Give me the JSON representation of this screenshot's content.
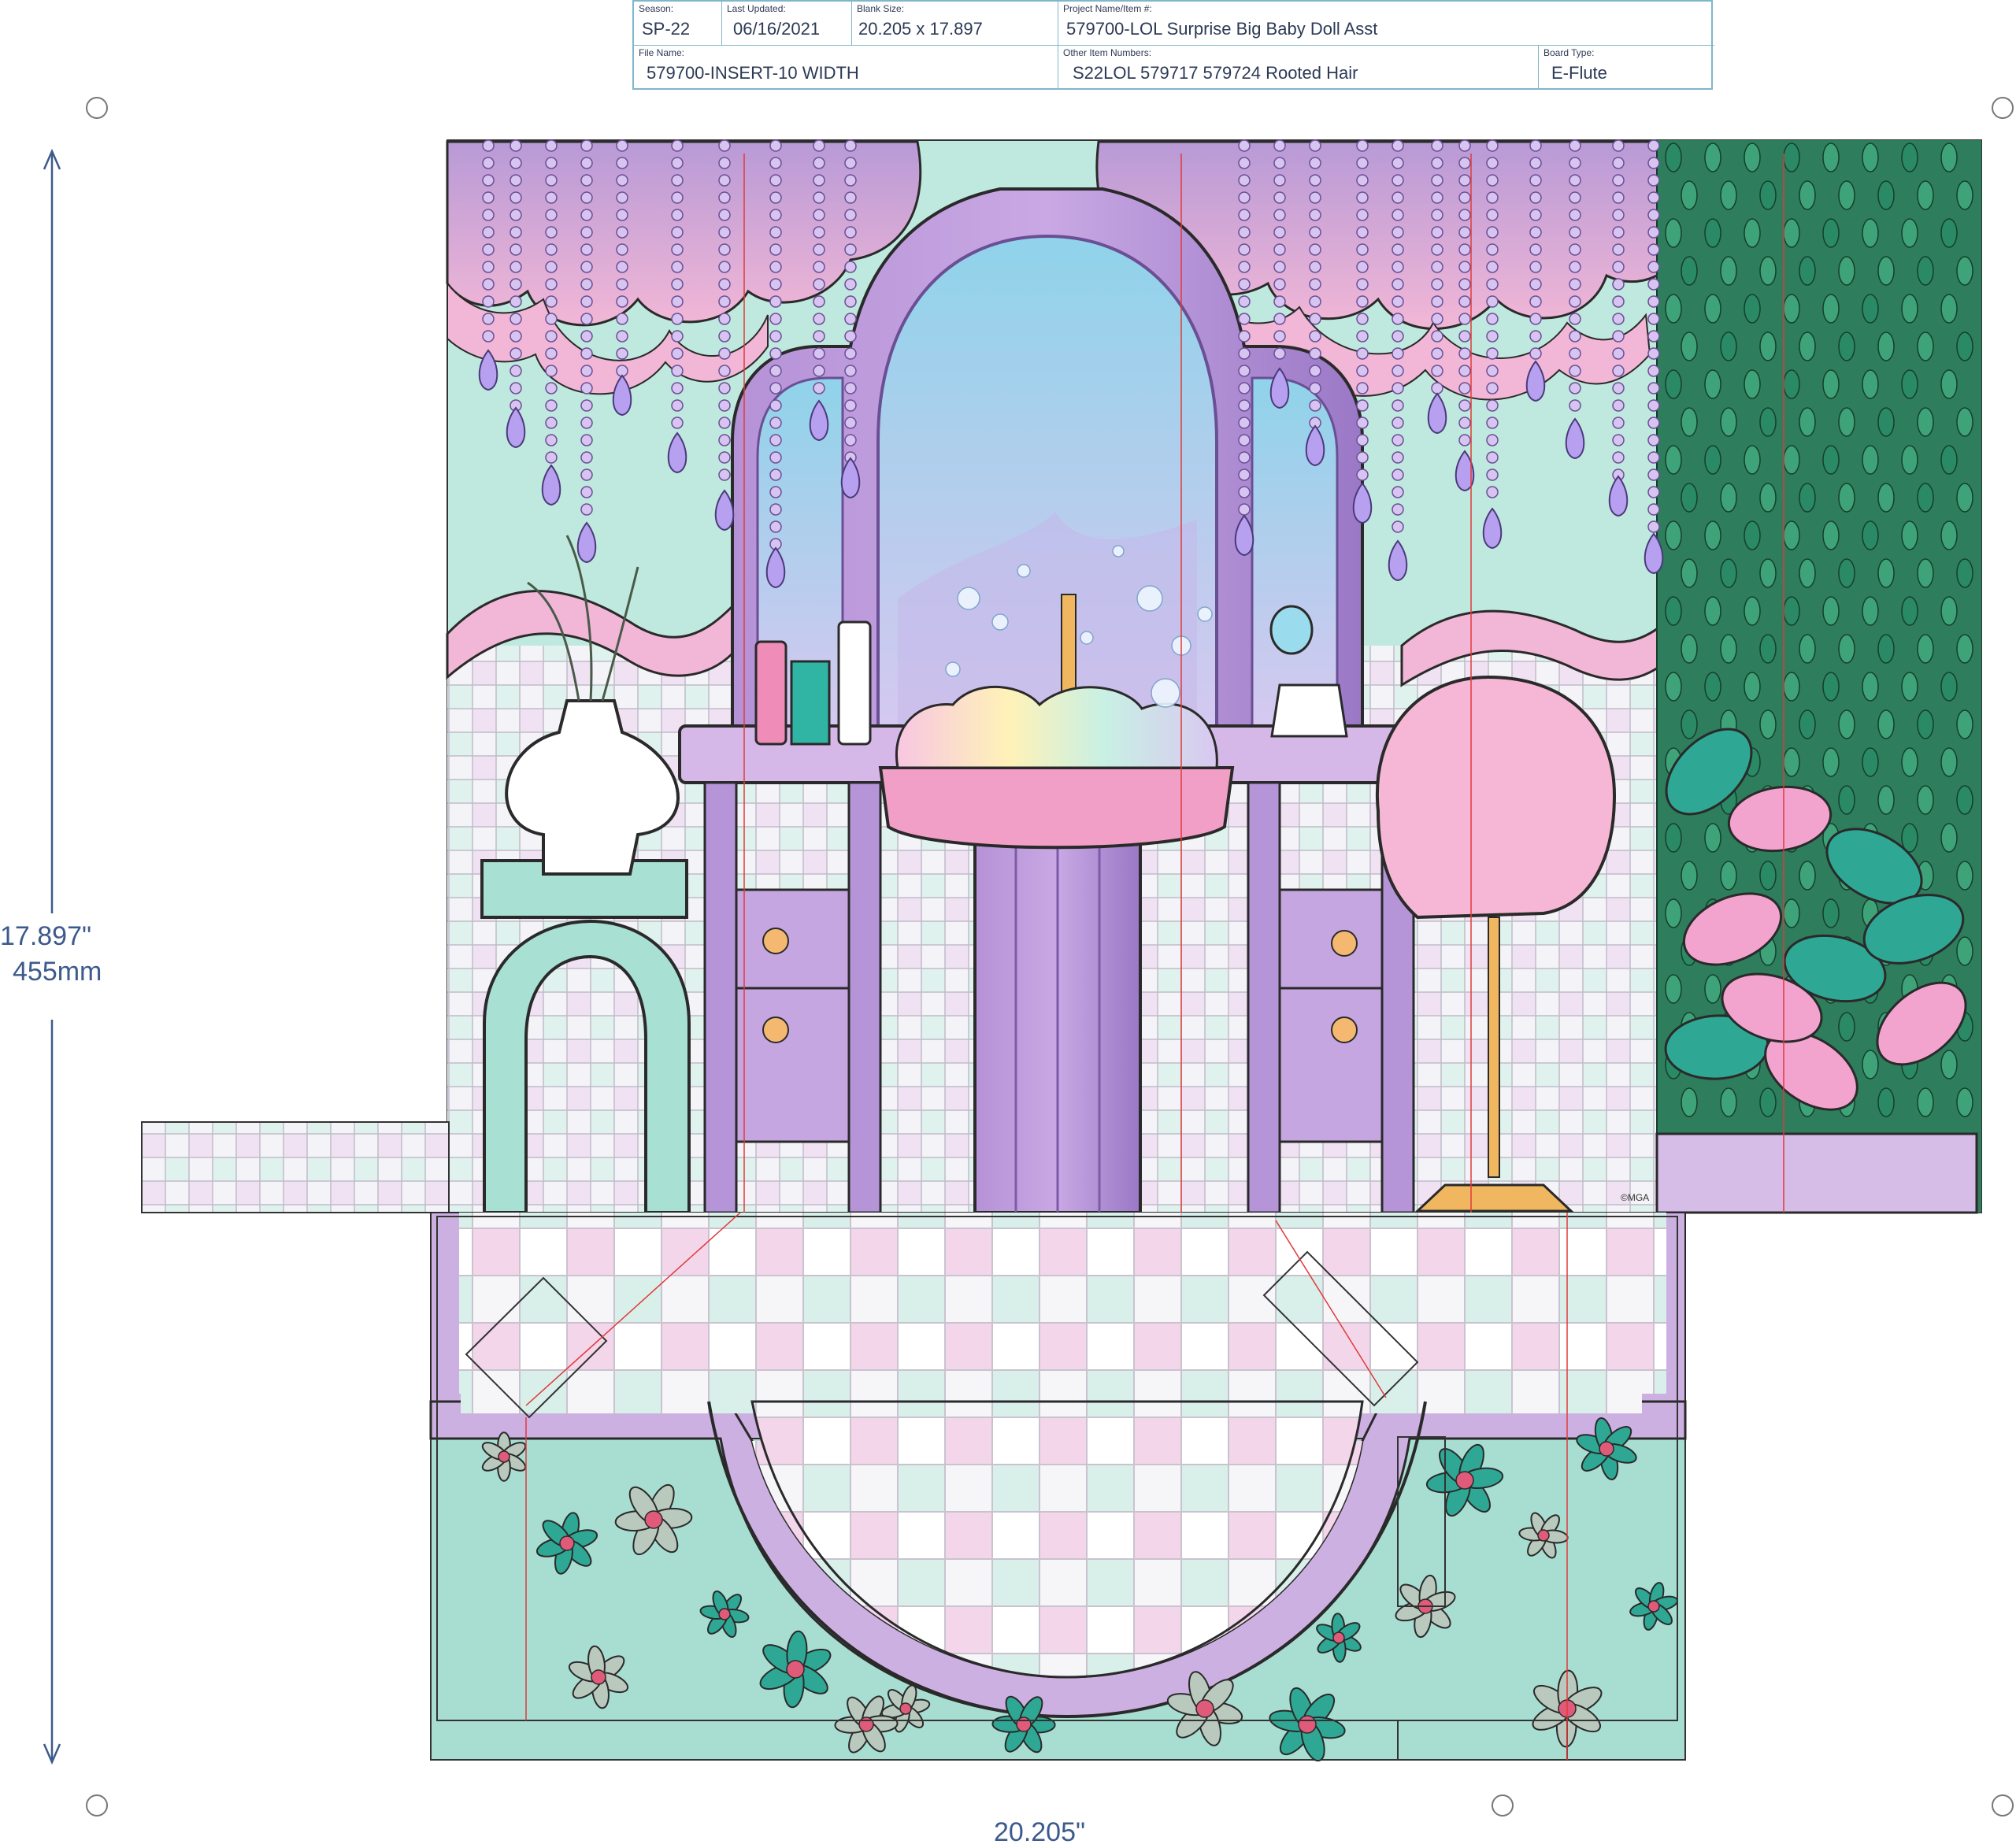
{
  "title_block": {
    "season_label": "Season:",
    "season_value": "SP-22",
    "last_updated_label": "Last Updated:",
    "last_updated_value": "06/16/2021",
    "blank_size_label": "Blank Size:",
    "blank_size_value": "20.205 x 17.897",
    "project_label": "Project Name/Item #:",
    "project_value": "579700-LOL Surprise Big Baby Doll Asst",
    "file_name_label": "File Name:",
    "file_name_value": "579700-INSERT-10 WIDTH",
    "other_items_label": "Other Item Numbers:",
    "other_items_value": "S22LOL 579717 579724  Rooted Hair",
    "board_type_label": "Board Type:",
    "board_type_value": "E-Flute"
  },
  "dimensions": {
    "height_inches": "17.897\"",
    "height_mm": "455mm",
    "width_inches": "20.205\""
  },
  "copyright": "©MGA",
  "colors": {
    "lavender": "#c9a8de",
    "purple": "#9d7fc4",
    "pink": "#f2b7d6",
    "mint": "#a8e0d4",
    "teal": "#2ea894",
    "mirror": "#a9dcec",
    "gold": "#f0b760",
    "dimension_blue": "#3d5a8c",
    "cut_line_red": "#e03a3a"
  }
}
